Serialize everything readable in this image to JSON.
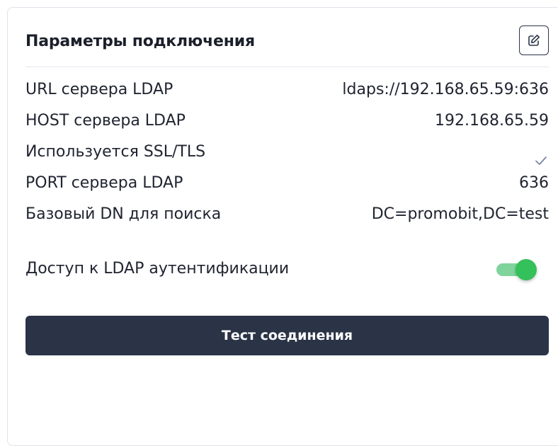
{
  "card": {
    "title": "Параметры подключения",
    "edit_icon": "edit-icon"
  },
  "fields": [
    {
      "label": "URL сервера LDAP",
      "value": "ldaps://192.168.65.59:636"
    },
    {
      "label": "HOST сервера LDAP",
      "value": "192.168.65.59"
    },
    {
      "label": "Используется SSL/TLS",
      "value": "",
      "icon": "check-icon"
    },
    {
      "label": "PORT сервера LDAP",
      "value": "636"
    },
    {
      "label": "Базовый DN для поиска",
      "value": "DC=promobit,DC=test"
    }
  ],
  "ldap_auth": {
    "label": "Доступ к LDAP аутентификации",
    "enabled": true
  },
  "test_button": {
    "label": "Тест соединения"
  },
  "colors": {
    "primary": "#2b3447",
    "toggle_on": "#34c05a",
    "toggle_track": "#7fd49c",
    "check": "#7a86a6"
  }
}
